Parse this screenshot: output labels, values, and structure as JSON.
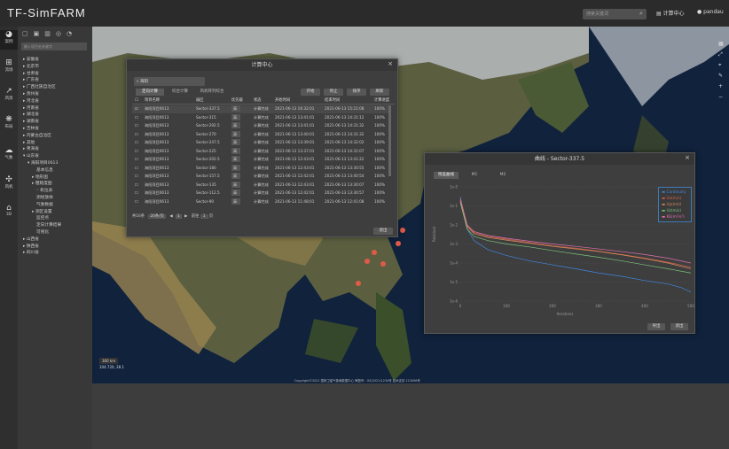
{
  "app": {
    "title": "TF-SimFARM",
    "search_placeholder": "搜索关键词",
    "calc_center": "计算中心",
    "user": "pandau"
  },
  "iconbar": [
    {
      "label": "案例",
      "icon": "case-icon"
    },
    {
      "label": "流场",
      "icon": "flowfield-icon"
    },
    {
      "label": "风资",
      "icon": "windres-icon"
    },
    {
      "label": "布局",
      "icon": "layout-icon"
    },
    {
      "label": "气象",
      "icon": "weather-icon"
    },
    {
      "label": "风机",
      "icon": "turbine-icon"
    },
    {
      "label": "3D",
      "icon": "3d-icon"
    }
  ],
  "sidebar": {
    "search_placeholder": "输入项目名关键字",
    "tree": [
      {
        "t": "▸ 安徽省",
        "d": 0
      },
      {
        "t": "▸ 北京市",
        "d": 0
      },
      {
        "t": "▸ 甘肃省",
        "d": 0
      },
      {
        "t": "▸ 广东省",
        "d": 0
      },
      {
        "t": "▸ 广西壮族自治区",
        "d": 0
      },
      {
        "t": "▸ 贵州省",
        "d": 0
      },
      {
        "t": "▸ 河北省",
        "d": 0
      },
      {
        "t": "▸ 河南省",
        "d": 0
      },
      {
        "t": "▸ 湖北省",
        "d": 0
      },
      {
        "t": "▸ 湖南省",
        "d": 0
      },
      {
        "t": "▸ 吉林省",
        "d": 0
      },
      {
        "t": "▸ 内蒙古自治区",
        "d": 0
      },
      {
        "t": "▸ 其他",
        "d": 0
      },
      {
        "t": "▸ 青海省",
        "d": 0
      },
      {
        "t": "▾ 山东省",
        "d": 0
      },
      {
        "t": "▾ 海阳项目0613",
        "d": 1
      },
      {
        "t": "基本信息",
        "d": 3
      },
      {
        "t": "▸ 地形图",
        "d": 2
      },
      {
        "t": "▸ 粗糙度图",
        "d": 2
      },
      {
        "t": "◦ 机位表",
        "d": 3
      },
      {
        "t": "测绘放样",
        "d": 3
      },
      {
        "t": "气象数据",
        "d": 3
      },
      {
        "t": "▸ 测区设置",
        "d": 2
      },
      {
        "t": "监控点",
        "d": 3
      },
      {
        "t": "定向计算结果",
        "d": 3
      },
      {
        "t": "可视化",
        "d": 3
      },
      {
        "t": "▸ 山西省",
        "d": 0
      },
      {
        "t": "▸ 陕西省",
        "d": 0
      },
      {
        "t": "▸ 四川省",
        "d": 0
      }
    ]
  },
  "calc": {
    "title": "计算中心",
    "search_value": "海阳",
    "tabs": [
      "定向计算",
      "综合计算",
      "风机阵列综合"
    ],
    "actions": [
      "开始",
      "停止",
      "排序",
      "刷新"
    ],
    "headers": [
      "项目名称",
      "扇区",
      "优先级",
      "状态",
      "开始时间",
      "结束时间",
      "计算进度"
    ],
    "rows": [
      {
        "name": "海阳项目0613",
        "sector": "Sector-337.5",
        "priority": "高",
        "status": "计算完成",
        "start": "2021-06-13 16:32:01",
        "end": "2021-06-13 15:21:08",
        "progress": "100%"
      },
      {
        "name": "海阳项目0613",
        "sector": "Sector-315",
        "priority": "高",
        "status": "计算完成",
        "start": "2021-06-13 13:41:01",
        "end": "2021-06-13 14:31:12",
        "progress": "100%"
      },
      {
        "name": "海阳项目0613",
        "sector": "Sector-292.5",
        "priority": "高",
        "status": "计算完成",
        "start": "2021-06-13 13:41:01",
        "end": "2021-06-13 14:31:32",
        "progress": "100%"
      },
      {
        "name": "海阳项目0613",
        "sector": "Sector-270",
        "priority": "高",
        "status": "计算完成",
        "start": "2021-06-13 13:40:01",
        "end": "2021-06-13 14:31:32",
        "progress": "100%"
      },
      {
        "name": "海阳项目0613",
        "sector": "Sector-247.5",
        "priority": "高",
        "status": "计算完成",
        "start": "2021-06-13 13:39:01",
        "end": "2021-06-13 14:32:02",
        "progress": "100%"
      },
      {
        "name": "海阳项目0613",
        "sector": "Sector-225",
        "priority": "高",
        "status": "计算完成",
        "start": "2021-06-13 13:37:01",
        "end": "2021-06-13 14:31:07",
        "progress": "100%"
      },
      {
        "name": "海阳项目0613",
        "sector": "Sector-202.5",
        "priority": "高",
        "status": "计算完成",
        "start": "2021-06-13 12:43:01",
        "end": "2021-06-13 13:41:22",
        "progress": "100%"
      },
      {
        "name": "海阳项目0613",
        "sector": "Sector-180",
        "priority": "高",
        "status": "计算完成",
        "start": "2021-06-13 12:43:01",
        "end": "2021-06-13 13:30:55",
        "progress": "100%"
      },
      {
        "name": "海阳项目0613",
        "sector": "Sector-157.5",
        "priority": "高",
        "status": "计算完成",
        "start": "2021-06-13 12:42:01",
        "end": "2021-06-13 13:40:54",
        "progress": "100%"
      },
      {
        "name": "海阳项目0613",
        "sector": "Sector-135",
        "priority": "高",
        "status": "计算完成",
        "start": "2021-06-13 12:43:01",
        "end": "2021-06-13 13:30:07",
        "progress": "100%"
      },
      {
        "name": "海阳项目0613",
        "sector": "Sector-112.5",
        "priority": "高",
        "status": "计算完成",
        "start": "2021-06-13 12:42:01",
        "end": "2021-06-13 13:30:57",
        "progress": "100%"
      },
      {
        "name": "海阳项目0613",
        "sector": "Sector-90",
        "priority": "高",
        "status": "计算完成",
        "start": "2021-06-13 11:48:01",
        "end": "2021-06-13 12:41:08",
        "progress": "100%"
      }
    ],
    "pager": {
      "total": "共16条",
      "page_size": "20条/页",
      "prev": "◀",
      "page": "1",
      "next": "▶",
      "goto": "前往",
      "goto_value": "1",
      "page_unit": "页"
    },
    "close_btn": "退出"
  },
  "curve": {
    "title": "曲线 - Sector-337.5",
    "tabs": [
      "残差曲线",
      "M1",
      "M2"
    ],
    "buttons": [
      "导出",
      "退出"
    ],
    "ylabel": "Residual",
    "xlabel": "Iterations",
    "chart_data": {
      "type": "line",
      "xlim": [
        0,
        500
      ],
      "ylim_log10": [
        -6,
        0
      ],
      "y_ticks": [
        "1e-0",
        "1e-1",
        "1e-2",
        "1e-3",
        "1e-4",
        "1e-5",
        "1e-6"
      ],
      "x_ticks": [
        "0",
        "100",
        "200",
        "300",
        "400",
        "500"
      ],
      "series": [
        {
          "name": "Continuity",
          "color": "#3f86e0",
          "x": [
            0,
            15,
            30,
            60,
            100,
            150,
            200,
            250,
            300,
            350,
            400,
            450,
            480,
            500
          ],
          "y": [
            0.3,
            0.006,
            0.0015,
            0.0005,
            0.00025,
            0.00013,
            8e-05,
            5e-05,
            3e-05,
            2e-05,
            1.2e-05,
            8e-06,
            5e-06,
            3e-06
          ]
        },
        {
          "name": "Ux(m/s)",
          "color": "#d4604a",
          "x": [
            0,
            15,
            30,
            60,
            100,
            150,
            200,
            250,
            300,
            350,
            400,
            450,
            500
          ],
          "y": [
            0.2,
            0.009,
            0.004,
            0.0025,
            0.0018,
            0.0012,
            0.0008,
            0.0006,
            0.00042,
            0.00028,
            0.00018,
            0.00011,
            6e-05
          ]
        },
        {
          "name": "Uy(m/s)",
          "color": "#d48a5a",
          "x": [
            0,
            15,
            30,
            60,
            100,
            150,
            200,
            250,
            300,
            350,
            400,
            450,
            500
          ],
          "y": [
            0.18,
            0.008,
            0.0035,
            0.0022,
            0.0016,
            0.0011,
            0.00075,
            0.00055,
            0.0004,
            0.00027,
            0.00017,
            0.0001,
            5e-05
          ]
        },
        {
          "name": "Uz(m/s)",
          "color": "#7cc27c",
          "x": [
            0,
            15,
            30,
            60,
            100,
            150,
            200,
            250,
            300,
            350,
            400,
            450,
            500
          ],
          "y": [
            0.15,
            0.006,
            0.0025,
            0.0015,
            0.001,
            0.0007,
            0.00045,
            0.0003,
            0.0002,
            0.00013,
            8e-05,
            5e-05,
            3e-05
          ]
        },
        {
          "name": "KE(m²/s²)",
          "color": "#e070b0",
          "x": [
            0,
            15,
            30,
            60,
            100,
            150,
            200,
            250,
            300,
            350,
            400,
            450,
            500
          ],
          "y": [
            0.25,
            0.01,
            0.0045,
            0.0028,
            0.002,
            0.0014,
            0.001,
            0.00075,
            0.00055,
            0.0004,
            0.00028,
            0.00018,
            0.0001
          ]
        }
      ]
    }
  },
  "map": {
    "copyright": "Copyright©2021 国家卫星气象局数据中心 审图号：GS(2021)1234号 技术支持 123456号",
    "scale": "300 km",
    "coords": "104.720, 28.1"
  }
}
